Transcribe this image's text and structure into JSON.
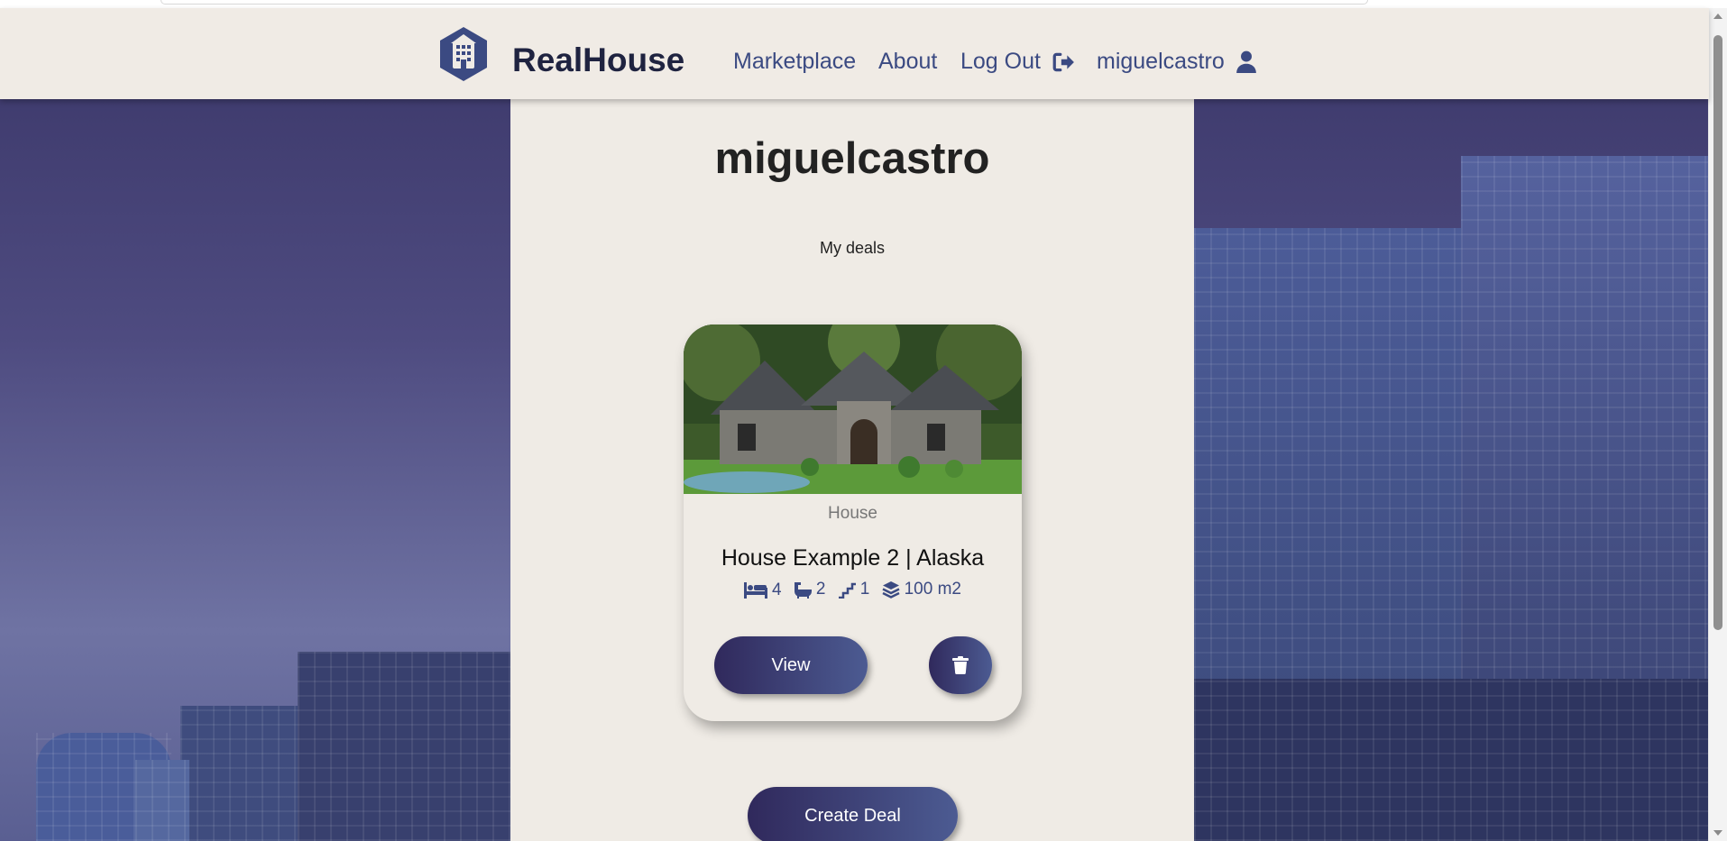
{
  "header": {
    "brand": "RealHouse",
    "nav": {
      "marketplace": "Marketplace",
      "about": "About",
      "logout": "Log Out",
      "user": "miguelcastro"
    }
  },
  "profile": {
    "username": "miguelcastro",
    "section_title": "My deals"
  },
  "deals": [
    {
      "type": "House",
      "title": "House Example 2 | Alaska",
      "bedrooms": "4",
      "bathrooms": "2",
      "floors": "1",
      "area": "100 m2",
      "view_label": "View"
    }
  ],
  "actions": {
    "create_label": "Create Deal"
  },
  "icons": {
    "logo": "building-hexagon-icon",
    "logout": "sign-out-icon",
    "user": "user-icon",
    "bed": "bed-icon",
    "bath": "bath-icon",
    "stairs": "stairs-icon",
    "area": "layers-icon",
    "delete": "trash-icon"
  },
  "colors": {
    "header_bg": "#f0ebe5",
    "panel_bg": "#efebe5",
    "nav_text": "#3b4a82",
    "brand_text": "#1f2340",
    "button_gradient_start": "#30295c",
    "button_gradient_end": "#4c5b92"
  }
}
